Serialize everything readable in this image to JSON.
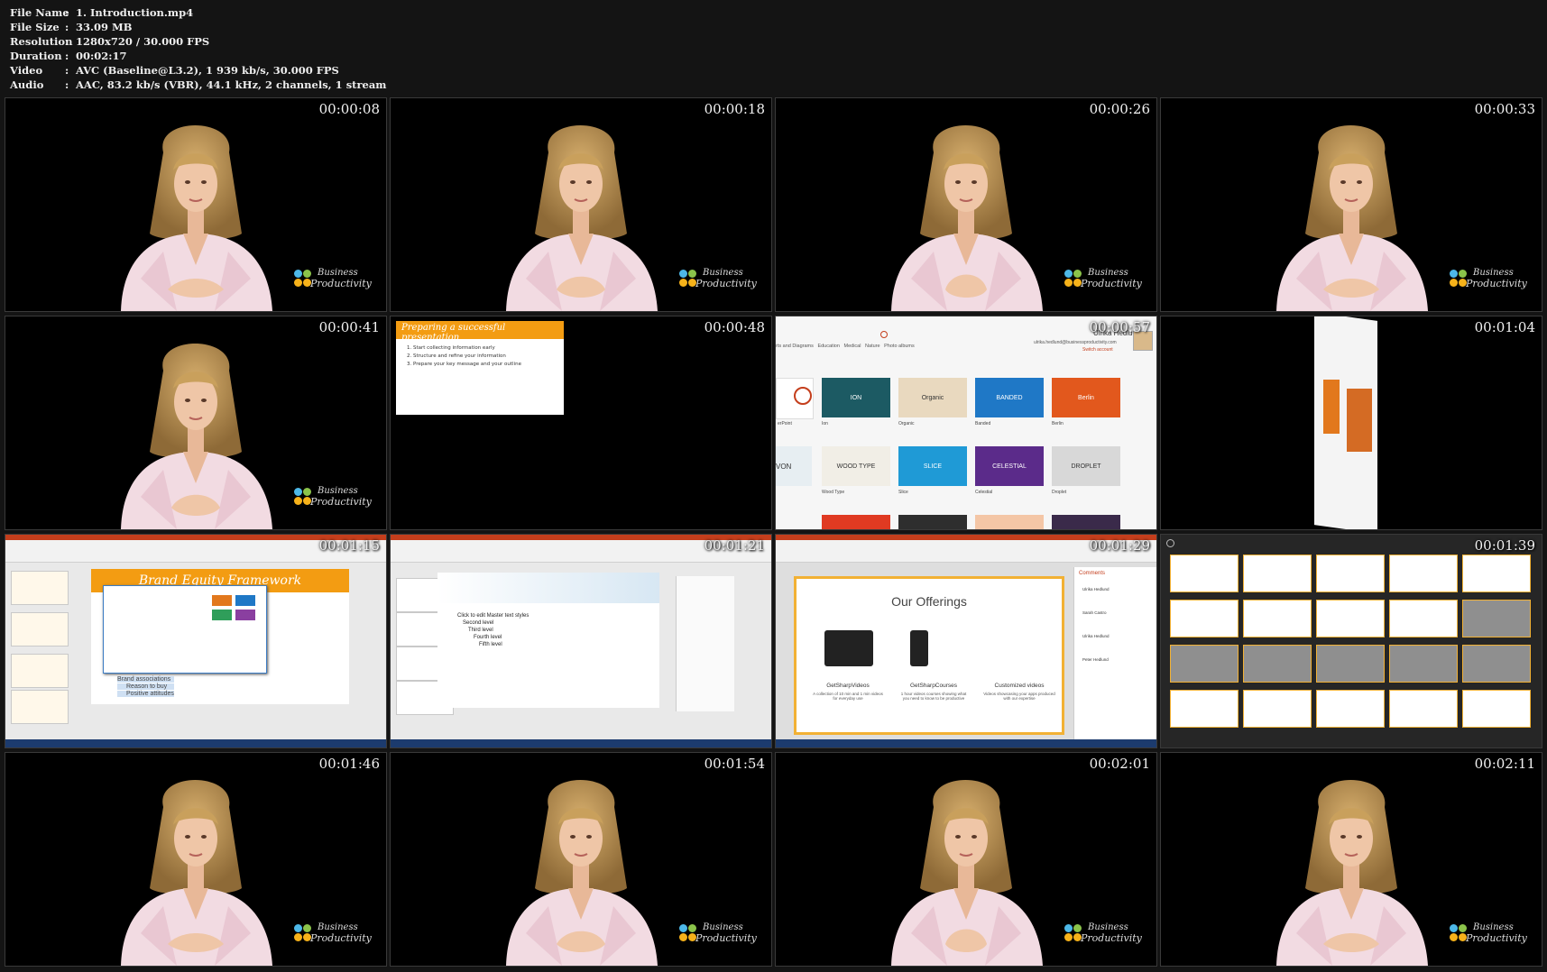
{
  "info": {
    "rows": [
      {
        "label": "File Name",
        "value": "1. Introduction.mp4"
      },
      {
        "label": "File Size",
        "value": "33.09 MB"
      },
      {
        "label": "Resolution",
        "value": "1280x720 / 30.000 FPS"
      },
      {
        "label": "Duration",
        "value": "00:02:17"
      },
      {
        "label": "Video",
        "value": "AVC (Baseline@L3.2), 1 939 kb/s, 30.000 FPS"
      },
      {
        "label": "Audio",
        "value": "AAC, 83.2 kb/s (VBR), 44.1 kHz, 2 channels, 1 stream"
      }
    ]
  },
  "logo": {
    "line1": "Business",
    "line2": "Productivity",
    "dot_colors": [
      "#4db8e8",
      "#8bc34a",
      "#f6b21a",
      "#f6b21a"
    ]
  },
  "thumbnails": [
    {
      "timestamp": "00:00:08",
      "type": "presenter"
    },
    {
      "timestamp": "00:00:18",
      "type": "presenter"
    },
    {
      "timestamp": "00:00:26",
      "type": "presenter"
    },
    {
      "timestamp": "00:00:33",
      "type": "presenter"
    },
    {
      "timestamp": "00:00:41",
      "type": "presenter"
    },
    {
      "timestamp": "00:00:48",
      "type": "slide"
    },
    {
      "timestamp": "00:00:57",
      "type": "themes"
    },
    {
      "timestamp": "00:01:04",
      "type": "flip"
    },
    {
      "timestamp": "00:01:15",
      "type": "ppt-brand"
    },
    {
      "timestamp": "00:01:21",
      "type": "ppt-master"
    },
    {
      "timestamp": "00:01:29",
      "type": "ppt-offerings"
    },
    {
      "timestamp": "00:01:39",
      "type": "slide-sorter"
    },
    {
      "timestamp": "00:01:46",
      "type": "presenter"
    },
    {
      "timestamp": "00:01:54",
      "type": "presenter"
    },
    {
      "timestamp": "00:02:01",
      "type": "presenter"
    },
    {
      "timestamp": "00:02:11",
      "type": "presenter"
    }
  ],
  "slide": {
    "title": "Preparing a successful presentation",
    "items": [
      "1.  Start collecting information early",
      "2.  Structure and refine your information",
      "3.  Prepare your key message and your outline"
    ]
  },
  "themes": {
    "nav": "rts and Diagrams   Education   Medical   Nature   Photo albums",
    "user_name": "Ulrika Hedlund",
    "user_email": "ulrika.hedlund@businessproductivity.com",
    "switch": "Switch account",
    "tiles": [
      {
        "label": "ION",
        "caption": "Ion",
        "color": "#1c5a63"
      },
      {
        "label": "Organic",
        "caption": "Organic",
        "color": "#e9d9bf"
      },
      {
        "label": "BANDED",
        "caption": "Banded",
        "color": "#1f78c6"
      },
      {
        "label": "Berlin",
        "caption": "Berlin",
        "color": "#e2581d"
      },
      {
        "label": "WOOD TYPE",
        "caption": "Wood Type",
        "color": "#f1eee6"
      },
      {
        "label": "SLICE",
        "caption": "Slice",
        "color": "#1f9ad6"
      },
      {
        "label": "CELESTIAL",
        "caption": "Celestial",
        "color": "#5b2b8a"
      },
      {
        "label": "DROPLET",
        "caption": "Droplet",
        "color": "#d8d8d8"
      }
    ],
    "left_labels": [
      "erPoint",
      "VON"
    ]
  },
  "brand": {
    "title": "Brand Equity Framework",
    "bullets": [
      "Brand associations",
      "Reason to buy",
      "Positive attitudes"
    ]
  },
  "master": {
    "levels": [
      "Click to edit Master text styles",
      "Second level",
      "Third level",
      "Fourth level",
      "Fifth level"
    ]
  },
  "offerings": {
    "title": "Our Offerings",
    "products": [
      {
        "name": "GetSharpVideos",
        "desc": "A collection of 10 min and 1 min videos for everyday use"
      },
      {
        "name": "GetSharpCourses",
        "desc": "1 hour videos courses showing what you need to know to be productive"
      },
      {
        "name": "Customized videos",
        "desc": "Videos showcasing your apps produced with our expertise"
      }
    ],
    "comments_title": "Comments",
    "commenters": [
      "Ulrika Hedlund",
      "Sarah Castro",
      "Ulrika Hedlund",
      "Peter Hedlund"
    ]
  }
}
